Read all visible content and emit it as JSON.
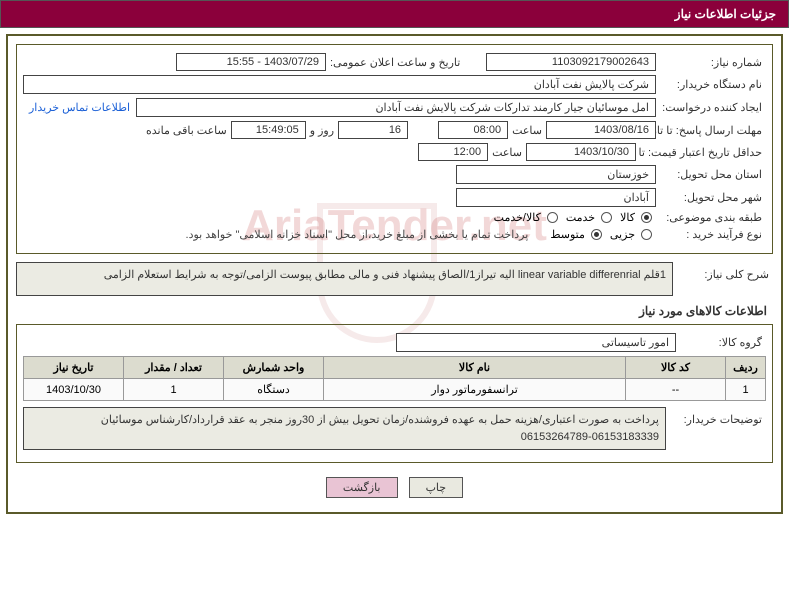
{
  "header": {
    "title": "جزئیات اطلاعات نیاز"
  },
  "fields": {
    "needNo_label": "شماره نیاز:",
    "needNo": "1103092179002643",
    "announceDate_label": "تاریخ و ساعت اعلان عمومی:",
    "announceDate": "1403/07/29 - 15:55",
    "buyerOrg_label": "نام دستگاه خریدار:",
    "buyerOrg": "شرکت پالایش نفت آبادان",
    "requester_label": "ایجاد کننده درخواست:",
    "requester": "امل موسائیان جیار کارمند تدارکات شرکت پالایش نفت آبادان",
    "contactLink": "اطلاعات تماس خریدار",
    "replyDeadline_label": "مهلت ارسال پاسخ: تا تاریخ:",
    "replyDeadline_date": "1403/08/16",
    "time_label": "ساعت",
    "replyDeadline_time": "08:00",
    "remaining_days": "16",
    "remaining_days_suffix": "روز و",
    "remaining_time": "15:49:05",
    "remaining_suffix": "ساعت باقی مانده",
    "priceValidity_label": "حداقل تاریخ اعتبار قیمت: تا تاریخ:",
    "priceValidity_date": "1403/10/30",
    "priceValidity_time": "12:00",
    "province_label": "استان محل تحویل:",
    "province": "خوزستان",
    "city_label": "شهر محل تحویل:",
    "city": "آبادان",
    "category_label": "طبقه بندی موضوعی:",
    "cat_kala": "کالا",
    "cat_khadmat": "خدمت",
    "cat_kalakhadmat": "کالا/خدمت",
    "purchaseType_label": "نوع فرآیند خرید :",
    "pt_jozi": "جزیی",
    "pt_motavaset": "متوسط",
    "purchaseNote": "پرداخت تمام یا بخشی از مبلغ خرید،از محل \"اسناد خزانه اسلامی\" خواهد بود.",
    "summary_label": "شرح کلی نیاز:",
    "summary": "1قلم linear variable differenrial الیه تیراز1/الصاق پیشنهاد فنی و مالی مطابق پیوست الزامی/توجه به شرایط استعلام الزامی",
    "itemsSection": "اطلاعات کالاهای مورد نیاز",
    "goodsGroup_label": "گروه کالا:",
    "goodsGroup": "امور تاسیساتی",
    "buyerNotes_label": "توضیحات خریدار:",
    "buyerNotes": "پرداخت به صورت اعتباری/هزینه حمل به عهده فروشنده/زمان تحویل بیش از 30روز منجر به عقد قرارداد/کارشناس موسائیان 06153183339-06153264789"
  },
  "table": {
    "headers": {
      "row": "ردیف",
      "code": "کد کالا",
      "name": "نام کالا",
      "unit": "واحد شمارش",
      "qty": "تعداد / مقدار",
      "date": "تاریخ نیاز"
    },
    "rows": [
      {
        "row": "1",
        "code": "--",
        "name": "ترانسفورماتور دوار",
        "unit": "دستگاه",
        "qty": "1",
        "date": "1403/10/30"
      }
    ]
  },
  "buttons": {
    "print": "چاپ",
    "back": "بازگشت"
  },
  "watermark": "AriaTender.net"
}
